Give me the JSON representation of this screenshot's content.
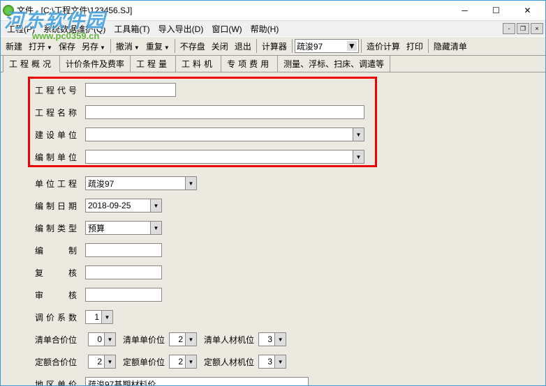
{
  "window": {
    "title": "文件 - [C:\\工程文件\\123456.SJ]"
  },
  "menu": {
    "items": [
      "工程(P)",
      "系统数据维护(Q)",
      "工具箱(T)",
      "导入导出(D)",
      "窗口(W)",
      "帮助(H)"
    ]
  },
  "toolbar": {
    "new": "新建",
    "open": "打开",
    "save": "保存",
    "saveas": "另存",
    "undo": "撤消",
    "redo": "重复",
    "nosave": "不存盘",
    "close": "关闭",
    "exit": "退出",
    "calc": "计算器",
    "combo_value": "疏浚97",
    "cost_calc": "造价计算",
    "print": "打印",
    "hide_list": "隐藏清单"
  },
  "tabs": {
    "t1": "工程概况",
    "t2": "计价条件及费率",
    "t3": "工程量",
    "t4": "工料机",
    "t5": "专项费用",
    "t6": "测量、浮标、扫床、调遣等"
  },
  "form": {
    "proj_code_label": "工程代号",
    "proj_code": "",
    "proj_name_label": "工程名称",
    "proj_name": "",
    "build_unit_label": "建设单位",
    "build_unit": "",
    "compile_unit_label": "编制单位",
    "compile_unit": "",
    "unit_proj_label": "单位工程",
    "unit_proj": "疏浚97",
    "compile_date_label": "编制日期",
    "compile_date": "2018-09-25",
    "compile_type_label": "编制类型",
    "compile_type": "预算",
    "compiler_label": "编制",
    "compiler": "",
    "reviewer_label": "复核",
    "reviewer": "",
    "auditor_label": "审核",
    "auditor": "",
    "adjust_coef_label": "调价系数",
    "adjust_coef": "1",
    "list_total_pos_label": "清单合价位",
    "list_total_pos": "0",
    "list_unit_pos_label": "清单单价位",
    "list_unit_pos": "2",
    "list_mat_pos_label": "清单人材机位",
    "list_mat_pos": "3",
    "quota_total_pos_label": "定额合价位",
    "quota_total_pos": "2",
    "quota_unit_pos_label": "定额单价位",
    "quota_unit_pos": "2",
    "quota_mat_pos_label": "定额人材机位",
    "quota_mat_pos": "3",
    "region_price_label": "地区单价",
    "region_price": "疏浚97基期材料价"
  },
  "watermark": {
    "text": "河东软件园",
    "url": "www.pc0359.cn"
  }
}
